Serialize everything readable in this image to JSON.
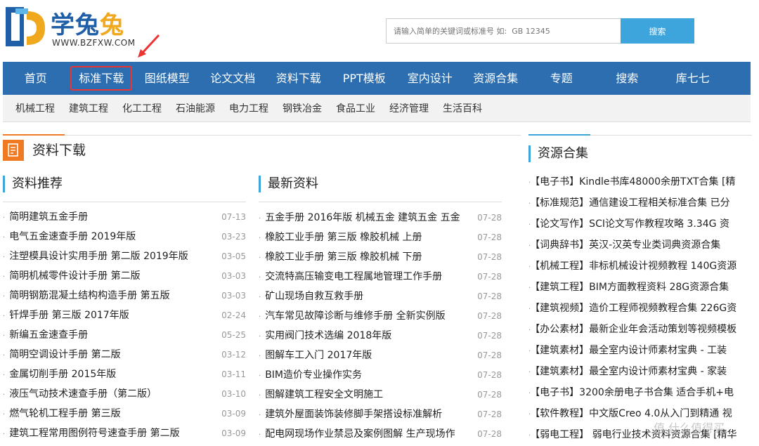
{
  "logo": {
    "name_a": "学",
    "name_b": "兔",
    "name_c": "兔",
    "url": "WWW.BZFXW.COM"
  },
  "search": {
    "placeholder": "请输入简单的关键词或标准号 如:  GB 12345",
    "button": "搜索"
  },
  "main_nav": [
    "首页",
    "标准下载",
    "图纸模型",
    "论文文档",
    "资料下载",
    "PPT模板",
    "室内设计",
    "资源合集",
    "专题",
    "搜索",
    "库七七"
  ],
  "sub_nav": [
    "机械工程",
    "建筑工程",
    "化工工程",
    "石油能源",
    "电力工程",
    "钢铁冶金",
    "食品工业",
    "经济管理",
    "生活百科"
  ],
  "section": {
    "title": "资料下载"
  },
  "recommend": {
    "heading": "资料推荐",
    "items": [
      {
        "title": "简明建筑五金手册",
        "date": "07-13"
      },
      {
        "title": "电气五金速查手册 2019年版",
        "date": "03-23"
      },
      {
        "title": "注塑模具设计实用手册 第二版 2019年版",
        "date": "03-05"
      },
      {
        "title": "简明机械零件设计手册 第二版",
        "date": "03-03"
      },
      {
        "title": "简明钢筋混凝土结构构造手册 第五版",
        "date": "03-03"
      },
      {
        "title": "钎焊手册 第三版 2017年版",
        "date": "02-24"
      },
      {
        "title": "新编五金速查手册",
        "date": "05-25"
      },
      {
        "title": "简明空调设计手册 第二版",
        "date": "03-12"
      },
      {
        "title": "金属切削手册 2015年版",
        "date": "03-11"
      },
      {
        "title": "液压气动技术速查手册（第二版）",
        "date": "03-10"
      },
      {
        "title": "燃气轮机工程手册 第三版",
        "date": "03-09"
      },
      {
        "title": "建筑工程常用图例符号速查手册 第二版",
        "date": "03-09"
      }
    ]
  },
  "latest": {
    "heading": "最新资料",
    "items": [
      {
        "title": "五金手册 2016年版 机械五金 建筑五金 五金",
        "date": "07-28"
      },
      {
        "title": "橡胶工业手册 第三版 橡胶机械 上册",
        "date": "07-28"
      },
      {
        "title": "橡胶工业手册 第三版 橡胶机械 下册",
        "date": "07-28"
      },
      {
        "title": "交流特高压输变电工程属地管理工作手册",
        "date": "07-28"
      },
      {
        "title": "矿山现场自救互救手册",
        "date": "07-28"
      },
      {
        "title": "汽车常见故障诊断与维修手册 全新实例版",
        "date": "07-28"
      },
      {
        "title": "实用阀门技术选编 2018年版",
        "date": "07-28"
      },
      {
        "title": "图解车工入门 2017年版",
        "date": "07-28"
      },
      {
        "title": "BIM造价专业操作实务",
        "date": "07-28"
      },
      {
        "title": "图解建筑工程安全文明施工",
        "date": "07-28"
      },
      {
        "title": "建筑外屋面装饰装修脚手架搭设标准解析",
        "date": "07-28"
      },
      {
        "title": "配电网现场作业禁忌及案例图解 生产现场作",
        "date": "07-28"
      }
    ]
  },
  "collection": {
    "heading": "资源合集",
    "items": [
      "【电子书】Kindle书库48000余册TXT合集 [精",
      "【标准规范】通信建设工程相关标准合集 已分",
      "【论文写作】SCI论文写作教程攻略 3.34G 资",
      "【词典辞书】英汉-汉英专业类词典资源合集",
      "【机械工程】非标机械设计视频教程 140G资源",
      "【建筑工程】BIM方面教程资料 28G资源合集",
      "【建筑视频】造价工程师视频教程合集 226G资",
      "【办公素材】最新企业年会活动策划等视频模板",
      "【建筑素材】最全室内设计师素材宝典 - 工装",
      "【建筑素材】最全室内设计师素材宝典 - 家装",
      "【电子书】3200余册电子书合集 适合手机+电",
      "【软件教程】中文版Creo 4.0从入门到精通 视",
      "【弱电工程】 弱电行业技术资料资源合集 [精华"
    ]
  },
  "watermark": "值 什么值得买",
  "colors": {
    "nav_blue": "#2d6eb0",
    "accent_orange": "#f07a22",
    "accent_blue": "#3da4dc",
    "highlight_red": "#e33"
  }
}
